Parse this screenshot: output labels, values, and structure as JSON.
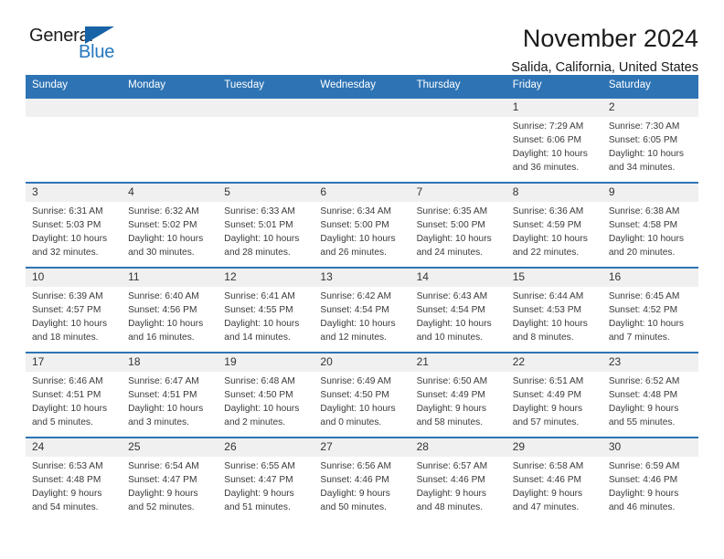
{
  "logo": {
    "word_one": "General",
    "word_two": "Blue",
    "triangle_icon": "triangle-icon",
    "accent_color": "#1763a6",
    "text_color": "#2477bd"
  },
  "header": {
    "month_title": "November 2024",
    "location": "Salida, California, United States"
  },
  "theme": {
    "header_blue": "#2e74b5",
    "daynum_band": "#f0f0f0",
    "body_text": "#3a3a3a"
  },
  "calendar": {
    "weekday_headers": [
      "Sunday",
      "Monday",
      "Tuesday",
      "Wednesday",
      "Thursday",
      "Friday",
      "Saturday"
    ],
    "weeks": [
      [
        {
          "day": "",
          "empty": true,
          "sunrise": "",
          "sunset": "",
          "daylight_line1": "",
          "daylight_line2": ""
        },
        {
          "day": "",
          "empty": true,
          "sunrise": "",
          "sunset": "",
          "daylight_line1": "",
          "daylight_line2": ""
        },
        {
          "day": "",
          "empty": true,
          "sunrise": "",
          "sunset": "",
          "daylight_line1": "",
          "daylight_line2": ""
        },
        {
          "day": "",
          "empty": true,
          "sunrise": "",
          "sunset": "",
          "daylight_line1": "",
          "daylight_line2": ""
        },
        {
          "day": "",
          "empty": true,
          "sunrise": "",
          "sunset": "",
          "daylight_line1": "",
          "daylight_line2": ""
        },
        {
          "day": "1",
          "empty": false,
          "sunrise": "Sunrise: 7:29 AM",
          "sunset": "Sunset: 6:06 PM",
          "daylight_line1": "Daylight: 10 hours",
          "daylight_line2": "and 36 minutes."
        },
        {
          "day": "2",
          "empty": false,
          "sunrise": "Sunrise: 7:30 AM",
          "sunset": "Sunset: 6:05 PM",
          "daylight_line1": "Daylight: 10 hours",
          "daylight_line2": "and 34 minutes."
        }
      ],
      [
        {
          "day": "3",
          "empty": false,
          "sunrise": "Sunrise: 6:31 AM",
          "sunset": "Sunset: 5:03 PM",
          "daylight_line1": "Daylight: 10 hours",
          "daylight_line2": "and 32 minutes."
        },
        {
          "day": "4",
          "empty": false,
          "sunrise": "Sunrise: 6:32 AM",
          "sunset": "Sunset: 5:02 PM",
          "daylight_line1": "Daylight: 10 hours",
          "daylight_line2": "and 30 minutes."
        },
        {
          "day": "5",
          "empty": false,
          "sunrise": "Sunrise: 6:33 AM",
          "sunset": "Sunset: 5:01 PM",
          "daylight_line1": "Daylight: 10 hours",
          "daylight_line2": "and 28 minutes."
        },
        {
          "day": "6",
          "empty": false,
          "sunrise": "Sunrise: 6:34 AM",
          "sunset": "Sunset: 5:00 PM",
          "daylight_line1": "Daylight: 10 hours",
          "daylight_line2": "and 26 minutes."
        },
        {
          "day": "7",
          "empty": false,
          "sunrise": "Sunrise: 6:35 AM",
          "sunset": "Sunset: 5:00 PM",
          "daylight_line1": "Daylight: 10 hours",
          "daylight_line2": "and 24 minutes."
        },
        {
          "day": "8",
          "empty": false,
          "sunrise": "Sunrise: 6:36 AM",
          "sunset": "Sunset: 4:59 PM",
          "daylight_line1": "Daylight: 10 hours",
          "daylight_line2": "and 22 minutes."
        },
        {
          "day": "9",
          "empty": false,
          "sunrise": "Sunrise: 6:38 AM",
          "sunset": "Sunset: 4:58 PM",
          "daylight_line1": "Daylight: 10 hours",
          "daylight_line2": "and 20 minutes."
        }
      ],
      [
        {
          "day": "10",
          "empty": false,
          "sunrise": "Sunrise: 6:39 AM",
          "sunset": "Sunset: 4:57 PM",
          "daylight_line1": "Daylight: 10 hours",
          "daylight_line2": "and 18 minutes."
        },
        {
          "day": "11",
          "empty": false,
          "sunrise": "Sunrise: 6:40 AM",
          "sunset": "Sunset: 4:56 PM",
          "daylight_line1": "Daylight: 10 hours",
          "daylight_line2": "and 16 minutes."
        },
        {
          "day": "12",
          "empty": false,
          "sunrise": "Sunrise: 6:41 AM",
          "sunset": "Sunset: 4:55 PM",
          "daylight_line1": "Daylight: 10 hours",
          "daylight_line2": "and 14 minutes."
        },
        {
          "day": "13",
          "empty": false,
          "sunrise": "Sunrise: 6:42 AM",
          "sunset": "Sunset: 4:54 PM",
          "daylight_line1": "Daylight: 10 hours",
          "daylight_line2": "and 12 minutes."
        },
        {
          "day": "14",
          "empty": false,
          "sunrise": "Sunrise: 6:43 AM",
          "sunset": "Sunset: 4:54 PM",
          "daylight_line1": "Daylight: 10 hours",
          "daylight_line2": "and 10 minutes."
        },
        {
          "day": "15",
          "empty": false,
          "sunrise": "Sunrise: 6:44 AM",
          "sunset": "Sunset: 4:53 PM",
          "daylight_line1": "Daylight: 10 hours",
          "daylight_line2": "and 8 minutes."
        },
        {
          "day": "16",
          "empty": false,
          "sunrise": "Sunrise: 6:45 AM",
          "sunset": "Sunset: 4:52 PM",
          "daylight_line1": "Daylight: 10 hours",
          "daylight_line2": "and 7 minutes."
        }
      ],
      [
        {
          "day": "17",
          "empty": false,
          "sunrise": "Sunrise: 6:46 AM",
          "sunset": "Sunset: 4:51 PM",
          "daylight_line1": "Daylight: 10 hours",
          "daylight_line2": "and 5 minutes."
        },
        {
          "day": "18",
          "empty": false,
          "sunrise": "Sunrise: 6:47 AM",
          "sunset": "Sunset: 4:51 PM",
          "daylight_line1": "Daylight: 10 hours",
          "daylight_line2": "and 3 minutes."
        },
        {
          "day": "19",
          "empty": false,
          "sunrise": "Sunrise: 6:48 AM",
          "sunset": "Sunset: 4:50 PM",
          "daylight_line1": "Daylight: 10 hours",
          "daylight_line2": "and 2 minutes."
        },
        {
          "day": "20",
          "empty": false,
          "sunrise": "Sunrise: 6:49 AM",
          "sunset": "Sunset: 4:50 PM",
          "daylight_line1": "Daylight: 10 hours",
          "daylight_line2": "and 0 minutes."
        },
        {
          "day": "21",
          "empty": false,
          "sunrise": "Sunrise: 6:50 AM",
          "sunset": "Sunset: 4:49 PM",
          "daylight_line1": "Daylight: 9 hours",
          "daylight_line2": "and 58 minutes."
        },
        {
          "day": "22",
          "empty": false,
          "sunrise": "Sunrise: 6:51 AM",
          "sunset": "Sunset: 4:49 PM",
          "daylight_line1": "Daylight: 9 hours",
          "daylight_line2": "and 57 minutes."
        },
        {
          "day": "23",
          "empty": false,
          "sunrise": "Sunrise: 6:52 AM",
          "sunset": "Sunset: 4:48 PM",
          "daylight_line1": "Daylight: 9 hours",
          "daylight_line2": "and 55 minutes."
        }
      ],
      [
        {
          "day": "24",
          "empty": false,
          "sunrise": "Sunrise: 6:53 AM",
          "sunset": "Sunset: 4:48 PM",
          "daylight_line1": "Daylight: 9 hours",
          "daylight_line2": "and 54 minutes."
        },
        {
          "day": "25",
          "empty": false,
          "sunrise": "Sunrise: 6:54 AM",
          "sunset": "Sunset: 4:47 PM",
          "daylight_line1": "Daylight: 9 hours",
          "daylight_line2": "and 52 minutes."
        },
        {
          "day": "26",
          "empty": false,
          "sunrise": "Sunrise: 6:55 AM",
          "sunset": "Sunset: 4:47 PM",
          "daylight_line1": "Daylight: 9 hours",
          "daylight_line2": "and 51 minutes."
        },
        {
          "day": "27",
          "empty": false,
          "sunrise": "Sunrise: 6:56 AM",
          "sunset": "Sunset: 4:46 PM",
          "daylight_line1": "Daylight: 9 hours",
          "daylight_line2": "and 50 minutes."
        },
        {
          "day": "28",
          "empty": false,
          "sunrise": "Sunrise: 6:57 AM",
          "sunset": "Sunset: 4:46 PM",
          "daylight_line1": "Daylight: 9 hours",
          "daylight_line2": "and 48 minutes."
        },
        {
          "day": "29",
          "empty": false,
          "sunrise": "Sunrise: 6:58 AM",
          "sunset": "Sunset: 4:46 PM",
          "daylight_line1": "Daylight: 9 hours",
          "daylight_line2": "and 47 minutes."
        },
        {
          "day": "30",
          "empty": false,
          "sunrise": "Sunrise: 6:59 AM",
          "sunset": "Sunset: 4:46 PM",
          "daylight_line1": "Daylight: 9 hours",
          "daylight_line2": "and 46 minutes."
        }
      ]
    ]
  }
}
